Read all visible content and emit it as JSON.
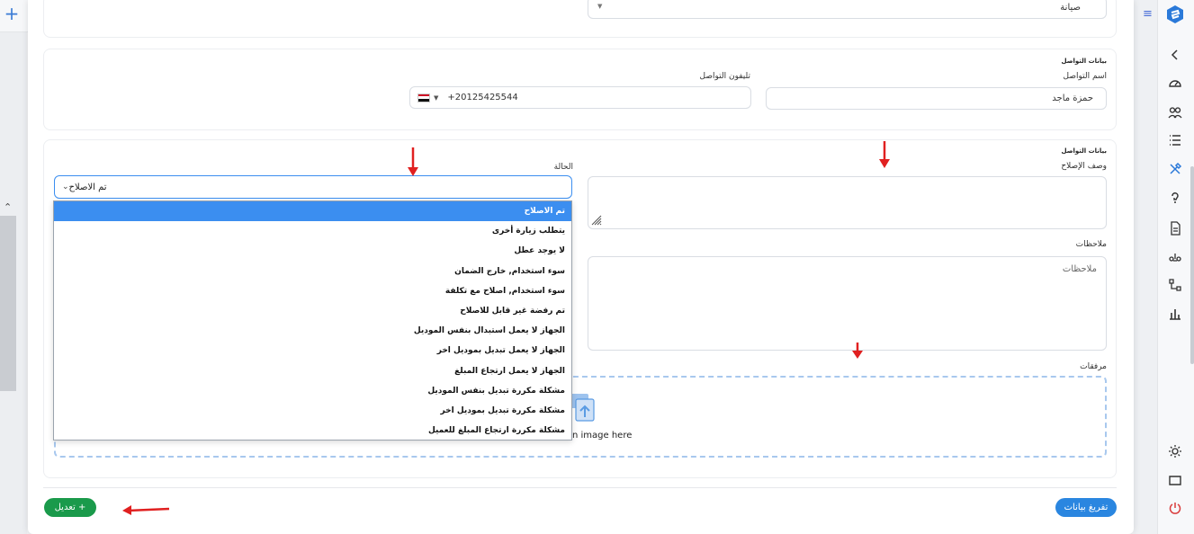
{
  "maintenance": {
    "type_value": "صيانة"
  },
  "contact": {
    "section_title": "بيانات التواصل",
    "name_label": "اسم التواصل",
    "name_value": "حمزة ماجد",
    "phone_label": "تليفون التواصل",
    "phone_value": "+20125425544"
  },
  "repair": {
    "section_title": "بيانات التواصل",
    "description_label": "وصف الإصلاح",
    "status_label": "الحالة",
    "status_value": "تم الاصلاح",
    "notes_label": "ملاحظات",
    "notes_placeholder": "ملاحظات",
    "attachments_label": "مرفقات",
    "dropzone_text": "n image here"
  },
  "status_options": [
    "تم الاصلاح",
    "يتطلب زيارة أخرى",
    "لا يوجد عطل",
    "سوء استخدام, خارج الضمان",
    "سوء استخدام, اصلاح مع تكلفة",
    "تم رفضة غير قابل للاصلاح",
    "الجهاز لا يعمل استبدال بنفس الموديل",
    "الجهاز لا يعمل تبديل بموديل اخر",
    "الجهاز لا يعمل ارتجاع المبلغ",
    "مشكلة مكررة تبديل بنفس الموديل",
    "مشكلة مكررة تبديل بموديل اخر",
    "مشكلة مكررة ارتجاع المبلغ للعميل"
  ],
  "footer": {
    "edit_label": "+ تعديل",
    "clear_label": "تفريغ بيانات"
  },
  "colors": {
    "accent": "#2a86e0",
    "success": "#1a9a4b",
    "annotation": "#e02020"
  }
}
